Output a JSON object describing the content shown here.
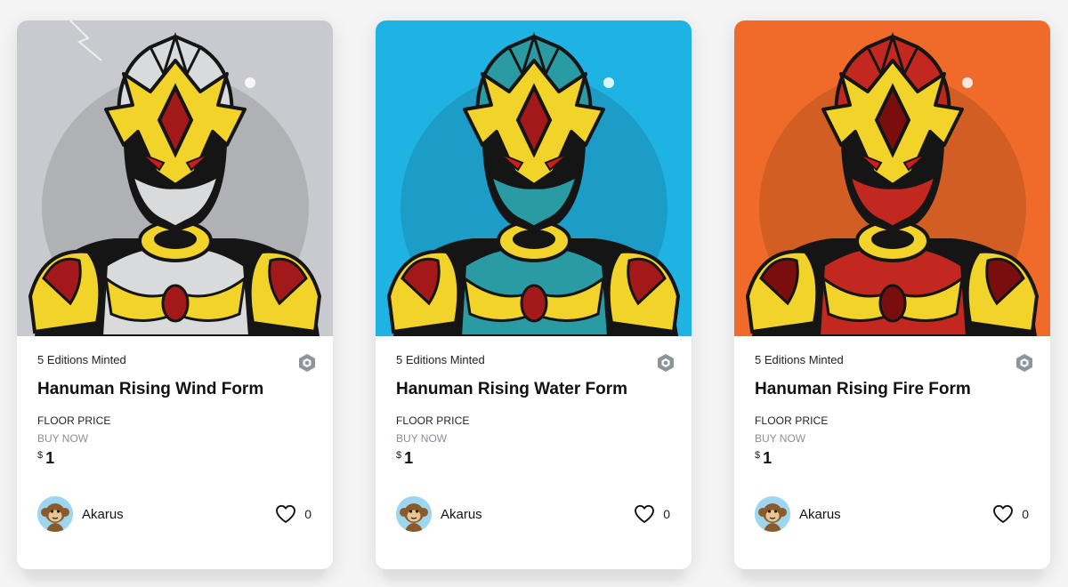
{
  "cards": [
    {
      "editions": "5 Editions Minted",
      "title": "Hanuman Rising Wind Form",
      "floor_label": "FLOOR PRICE",
      "buy_label": "BUY NOW",
      "currency": "$",
      "price": "1",
      "creator": "Akarus",
      "likes": "0",
      "background": "#c9cacf",
      "armor": "#d9dadc",
      "accent": "#a31818"
    },
    {
      "editions": "5 Editions Minted",
      "title": "Hanuman Rising Water Form",
      "floor_label": "FLOOR PRICE",
      "buy_label": "BUY NOW",
      "currency": "$",
      "price": "1",
      "creator": "Akarus",
      "likes": "0",
      "background": "#1fb3e4",
      "armor": "#2a9aa3",
      "accent": "#a31818"
    },
    {
      "editions": "5 Editions Minted",
      "title": "Hanuman Rising Fire Form",
      "floor_label": "FLOOR PRICE",
      "buy_label": "BUY NOW",
      "currency": "$",
      "price": "1",
      "creator": "Akarus",
      "likes": "0",
      "background": "#f06b2a",
      "armor": "#c2281f",
      "accent": "#7a0e0e"
    }
  ],
  "colors": {
    "gold": "#f1d32a",
    "gold_dark": "#c7a515",
    "outline": "#151515",
    "chain_icon": "#8f949c",
    "buy_now_text": "#8a8f99",
    "avatar_bg": "#9fd6ef"
  },
  "icons": {
    "chain": "hexagon-chain-icon",
    "like": "heart-outline-icon",
    "avatar": "monkey-avatar"
  }
}
